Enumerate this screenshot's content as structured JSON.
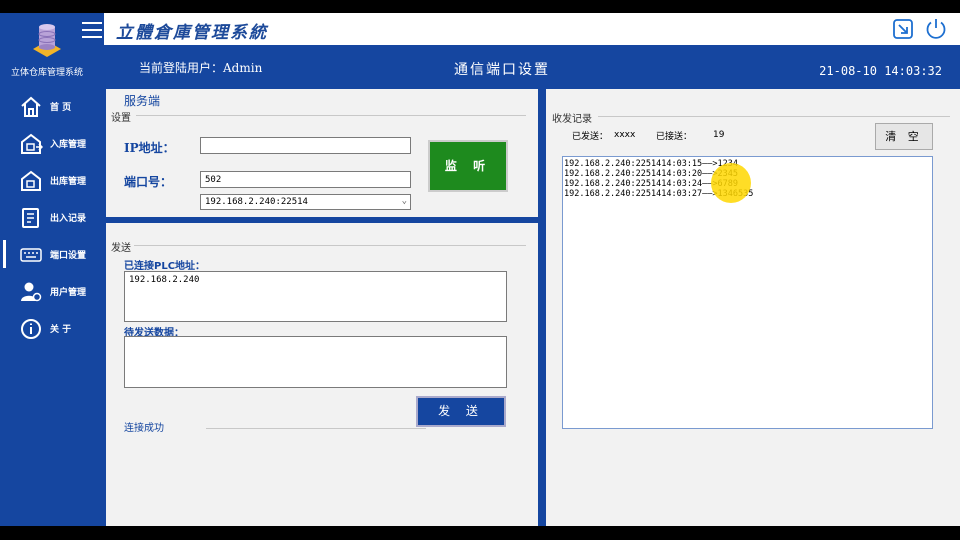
{
  "app": {
    "title": "立體倉庫管理系統",
    "system_name": "立体仓库管理系统",
    "current_user": "当前登陆用户：Admin",
    "page_title": "通信端口设置",
    "datetime": "21-08-10  14:03:32"
  },
  "colors": {
    "primary": "#1546a0",
    "listen_button": "#1e8a1e",
    "panel": "#f2f2f2"
  },
  "sidebar": {
    "items": [
      {
        "label": "首  页",
        "icon": "home-icon"
      },
      {
        "label": "入库管理",
        "icon": "inbound-icon"
      },
      {
        "label": "出库管理",
        "icon": "outbound-icon"
      },
      {
        "label": "出入记录",
        "icon": "records-icon"
      },
      {
        "label": "端口设置",
        "icon": "keyboard-icon"
      },
      {
        "label": "用户管理",
        "icon": "user-settings-icon"
      },
      {
        "label": "关  于",
        "icon": "info-icon"
      }
    ],
    "active_index": 4
  },
  "server": {
    "title": "服务端",
    "group": "设置",
    "ip_label": "IP地址：",
    "ip_value": "",
    "port_label": "端口号：",
    "port_value": "502",
    "client_select": "192.168.2.240:22514",
    "listen_button": "监 听"
  },
  "send": {
    "group": "发送",
    "connected_label": "已连接PLC地址：",
    "connected_value": "192.168.2.240",
    "pending_label": "待发送数据：",
    "pending_value": "",
    "send_button": "发 送",
    "status": "连接成功"
  },
  "log": {
    "group": "收发记录",
    "sent_label": "已发送：",
    "sent_value": "xxxx",
    "recv_label": "已接送：",
    "recv_value": "19",
    "clear_button": "清 空",
    "lines": [
      "192.168.2.240:2251414:03:15——>1234",
      "192.168.2.240:2251414:03:20——>2345",
      "192.168.2.240:2251414:03:24——>6789",
      "192.168.2.240:2251414:03:27——>1346535"
    ]
  }
}
